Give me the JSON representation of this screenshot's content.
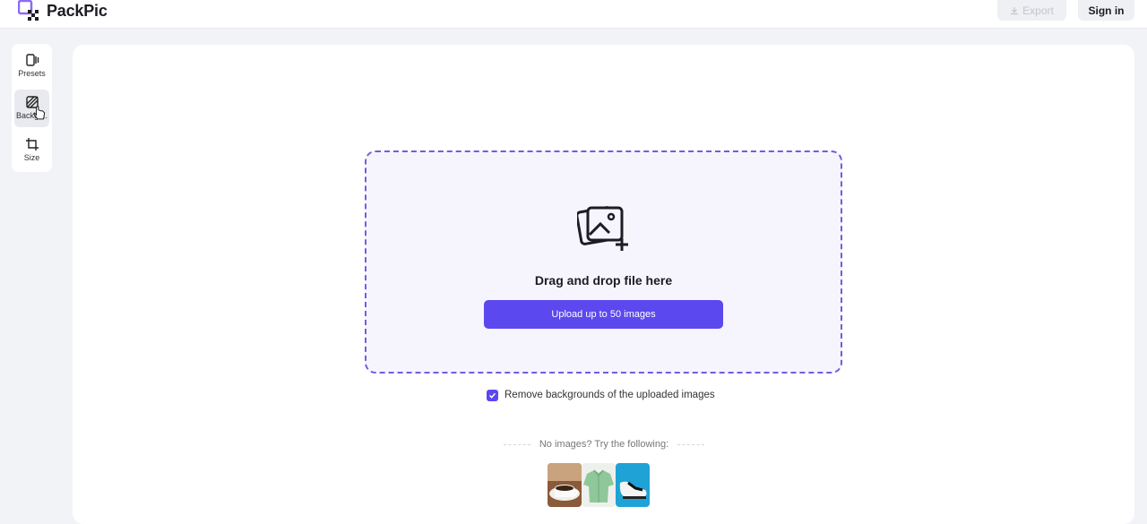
{
  "app": {
    "name": "PackPic",
    "logo_icon": "packpic-logo-icon",
    "accent_color": "#5b48ee"
  },
  "header": {
    "export_label": "Export",
    "export_icon": "download-icon",
    "signin_label": "Sign in"
  },
  "sidebar": {
    "items": [
      {
        "label": "Presets",
        "icon": "presets-icon",
        "active": false
      },
      {
        "label": "Backgr...",
        "icon": "background-icon",
        "active": true
      },
      {
        "label": "Size",
        "icon": "crop-icon",
        "active": false
      }
    ]
  },
  "dropzone": {
    "icon": "add-image-icon",
    "title": "Drag and drop file here",
    "button_label": "Upload up to 50 images"
  },
  "options": {
    "remove_bg_label": "Remove backgrounds of the uploaded images",
    "remove_bg_checked": true
  },
  "samples": {
    "label": "No images? Try the following:",
    "items": [
      {
        "name": "coffee-cup-sample"
      },
      {
        "name": "green-shirt-sample"
      },
      {
        "name": "sneaker-sample"
      }
    ]
  }
}
